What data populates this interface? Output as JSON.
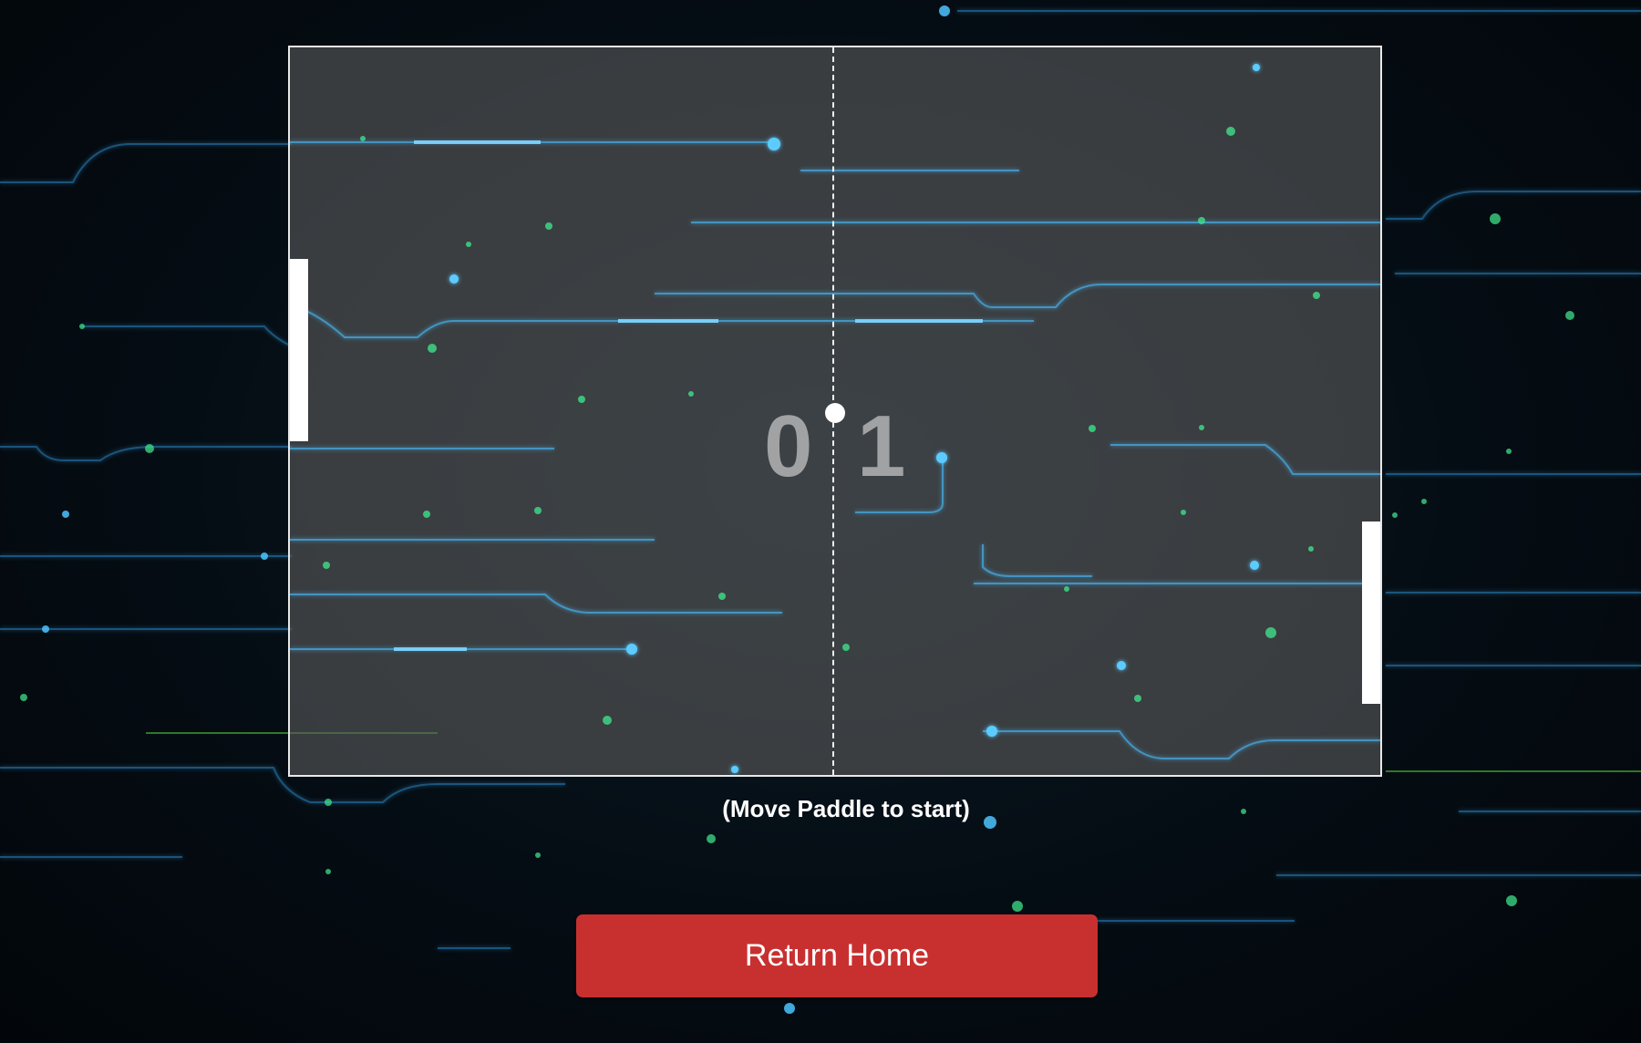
{
  "game": {
    "score_left": "0",
    "score_right": "1",
    "hint": "(Move Paddle to start)"
  },
  "buttons": {
    "return_home": "Return Home"
  },
  "colors": {
    "background": "#02070c",
    "board": "#5a5a5a",
    "circuit_blue": "#3fb6ff",
    "circuit_green": "#3fe08a",
    "button": "#c83030",
    "paddle": "#ffffff",
    "score": "#bebebe"
  }
}
